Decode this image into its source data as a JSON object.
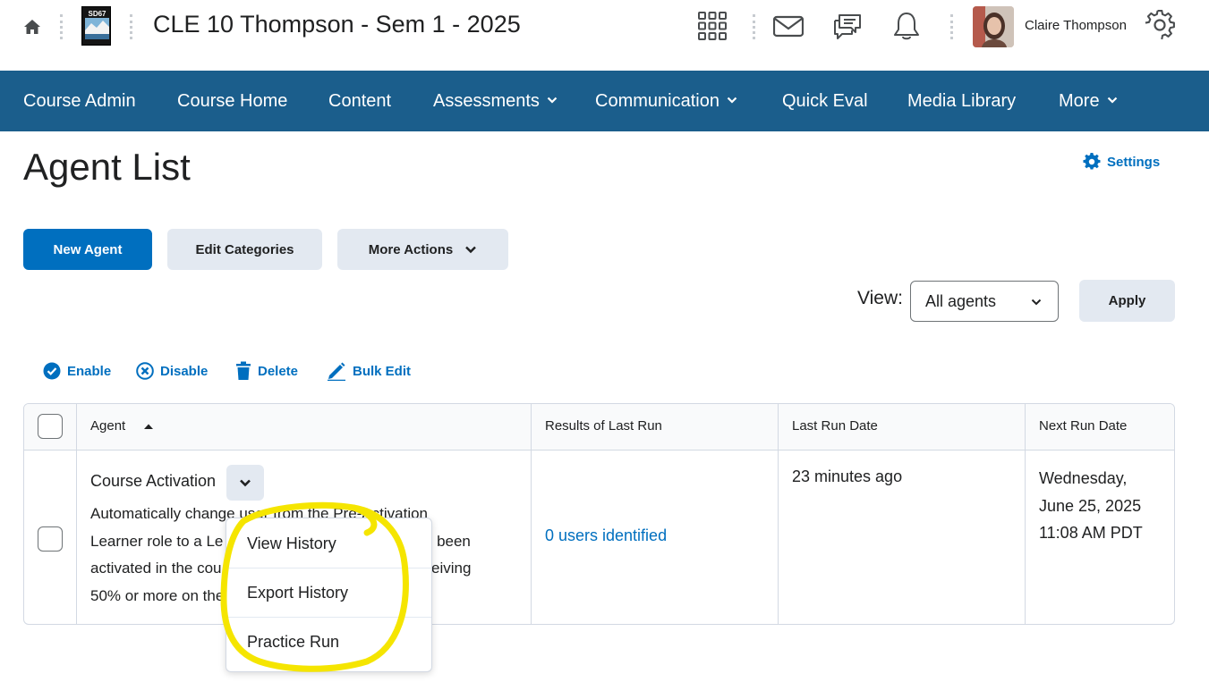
{
  "header": {
    "course_title": "CLE 10 Thompson - Sem 1 - 2025",
    "logo_text": "SD67",
    "user_name": "Claire Thompson",
    "icons": [
      "home-icon",
      "waffle-icon",
      "mail-icon",
      "chat-icon",
      "bell-icon",
      "gear-icon"
    ]
  },
  "nav": {
    "items": [
      {
        "label": "Course Admin"
      },
      {
        "label": "Course Home"
      },
      {
        "label": "Content"
      },
      {
        "label": "Assessments"
      },
      {
        "label": "Communication"
      },
      {
        "label": "Quick Eval"
      },
      {
        "label": "Media Library"
      },
      {
        "label": "More"
      }
    ]
  },
  "page": {
    "title": "Agent List",
    "settings_label": "Settings"
  },
  "toolbar": {
    "new_agent": "New Agent",
    "edit_categories": "Edit Categories",
    "more_actions": "More Actions"
  },
  "view": {
    "label": "View:",
    "selected": "All agents",
    "apply": "Apply"
  },
  "bulk_actions": {
    "enable": "Enable",
    "disable": "Disable",
    "delete": "Delete",
    "bulk_edit": "Bulk Edit"
  },
  "table": {
    "columns": [
      "Agent",
      "Results of Last Run",
      "Last Run Date",
      "Next Run Date"
    ],
    "rows": [
      {
        "agent_name": "Course Activation",
        "description_visible": [
          "Automatically chang",
          "e user from the Pre-Activation",
          "Learner role to a Le",
          "as been",
          "activated in the cou",
          "ceiving",
          "50% or more on the"
        ],
        "results": "0 users identified",
        "last_run": "23 minutes ago",
        "next_run_lines": [
          "Wednesday,",
          "June 25, 2025",
          "11:08 AM PDT"
        ]
      }
    ]
  },
  "row_menu": {
    "items": [
      "View History",
      "Export History",
      "Practice Run"
    ]
  },
  "colors": {
    "nav_bg": "#1b5e8c",
    "primary": "#006fbf",
    "secondary_btn": "#e3e9f1",
    "highlight": "#f5e500"
  }
}
